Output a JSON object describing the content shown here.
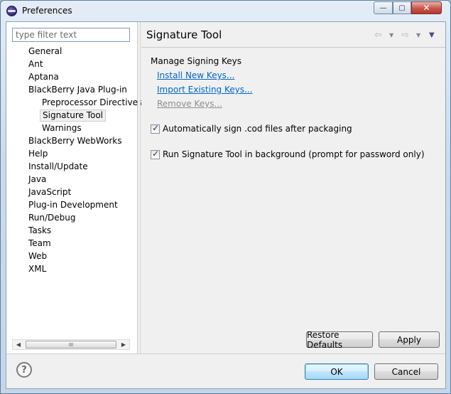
{
  "window": {
    "title": "Preferences",
    "controls": {
      "minimize": "—",
      "maximize": "▢",
      "close": "✕"
    }
  },
  "filter": {
    "placeholder": "type filter text"
  },
  "tree": {
    "items": [
      {
        "label": "General",
        "level": 0
      },
      {
        "label": "Ant",
        "level": 0
      },
      {
        "label": "Aptana",
        "level": 0
      },
      {
        "label": "BlackBerry Java Plug-in",
        "level": 0
      },
      {
        "label": "Preprocessor Directives",
        "level": 1
      },
      {
        "label": "Signature Tool",
        "level": 1,
        "selected": true
      },
      {
        "label": "Warnings",
        "level": 1
      },
      {
        "label": "BlackBerry WebWorks",
        "level": 0
      },
      {
        "label": "Help",
        "level": 0
      },
      {
        "label": "Install/Update",
        "level": 0
      },
      {
        "label": "Java",
        "level": 0
      },
      {
        "label": "JavaScript",
        "level": 0
      },
      {
        "label": "Plug-in Development",
        "level": 0
      },
      {
        "label": "Run/Debug",
        "level": 0
      },
      {
        "label": "Tasks",
        "level": 0
      },
      {
        "label": "Team",
        "level": 0
      },
      {
        "label": "Web",
        "level": 0
      },
      {
        "label": "XML",
        "level": 0
      }
    ],
    "scrollbar_grip": "III"
  },
  "page": {
    "title": "Signature Tool",
    "section_label": "Manage Signing Keys",
    "links": {
      "install": "Install New Keys...",
      "import": "Import Existing Keys...",
      "remove": "Remove Keys..."
    },
    "checkboxes": {
      "auto_sign": {
        "label": "Automatically sign .cod files after packaging",
        "checked": true
      },
      "background": {
        "label": "Run Signature Tool in background (prompt for password only)",
        "checked": true
      }
    },
    "restore_defaults": "Restore Defaults",
    "apply": "Apply"
  },
  "footer": {
    "ok": "OK",
    "cancel": "Cancel",
    "help_glyph": "?"
  },
  "icons": {
    "nav_back": "arrow-left-icon",
    "nav_forward": "arrow-right-icon",
    "view_menu": "chevron-down-icon"
  }
}
